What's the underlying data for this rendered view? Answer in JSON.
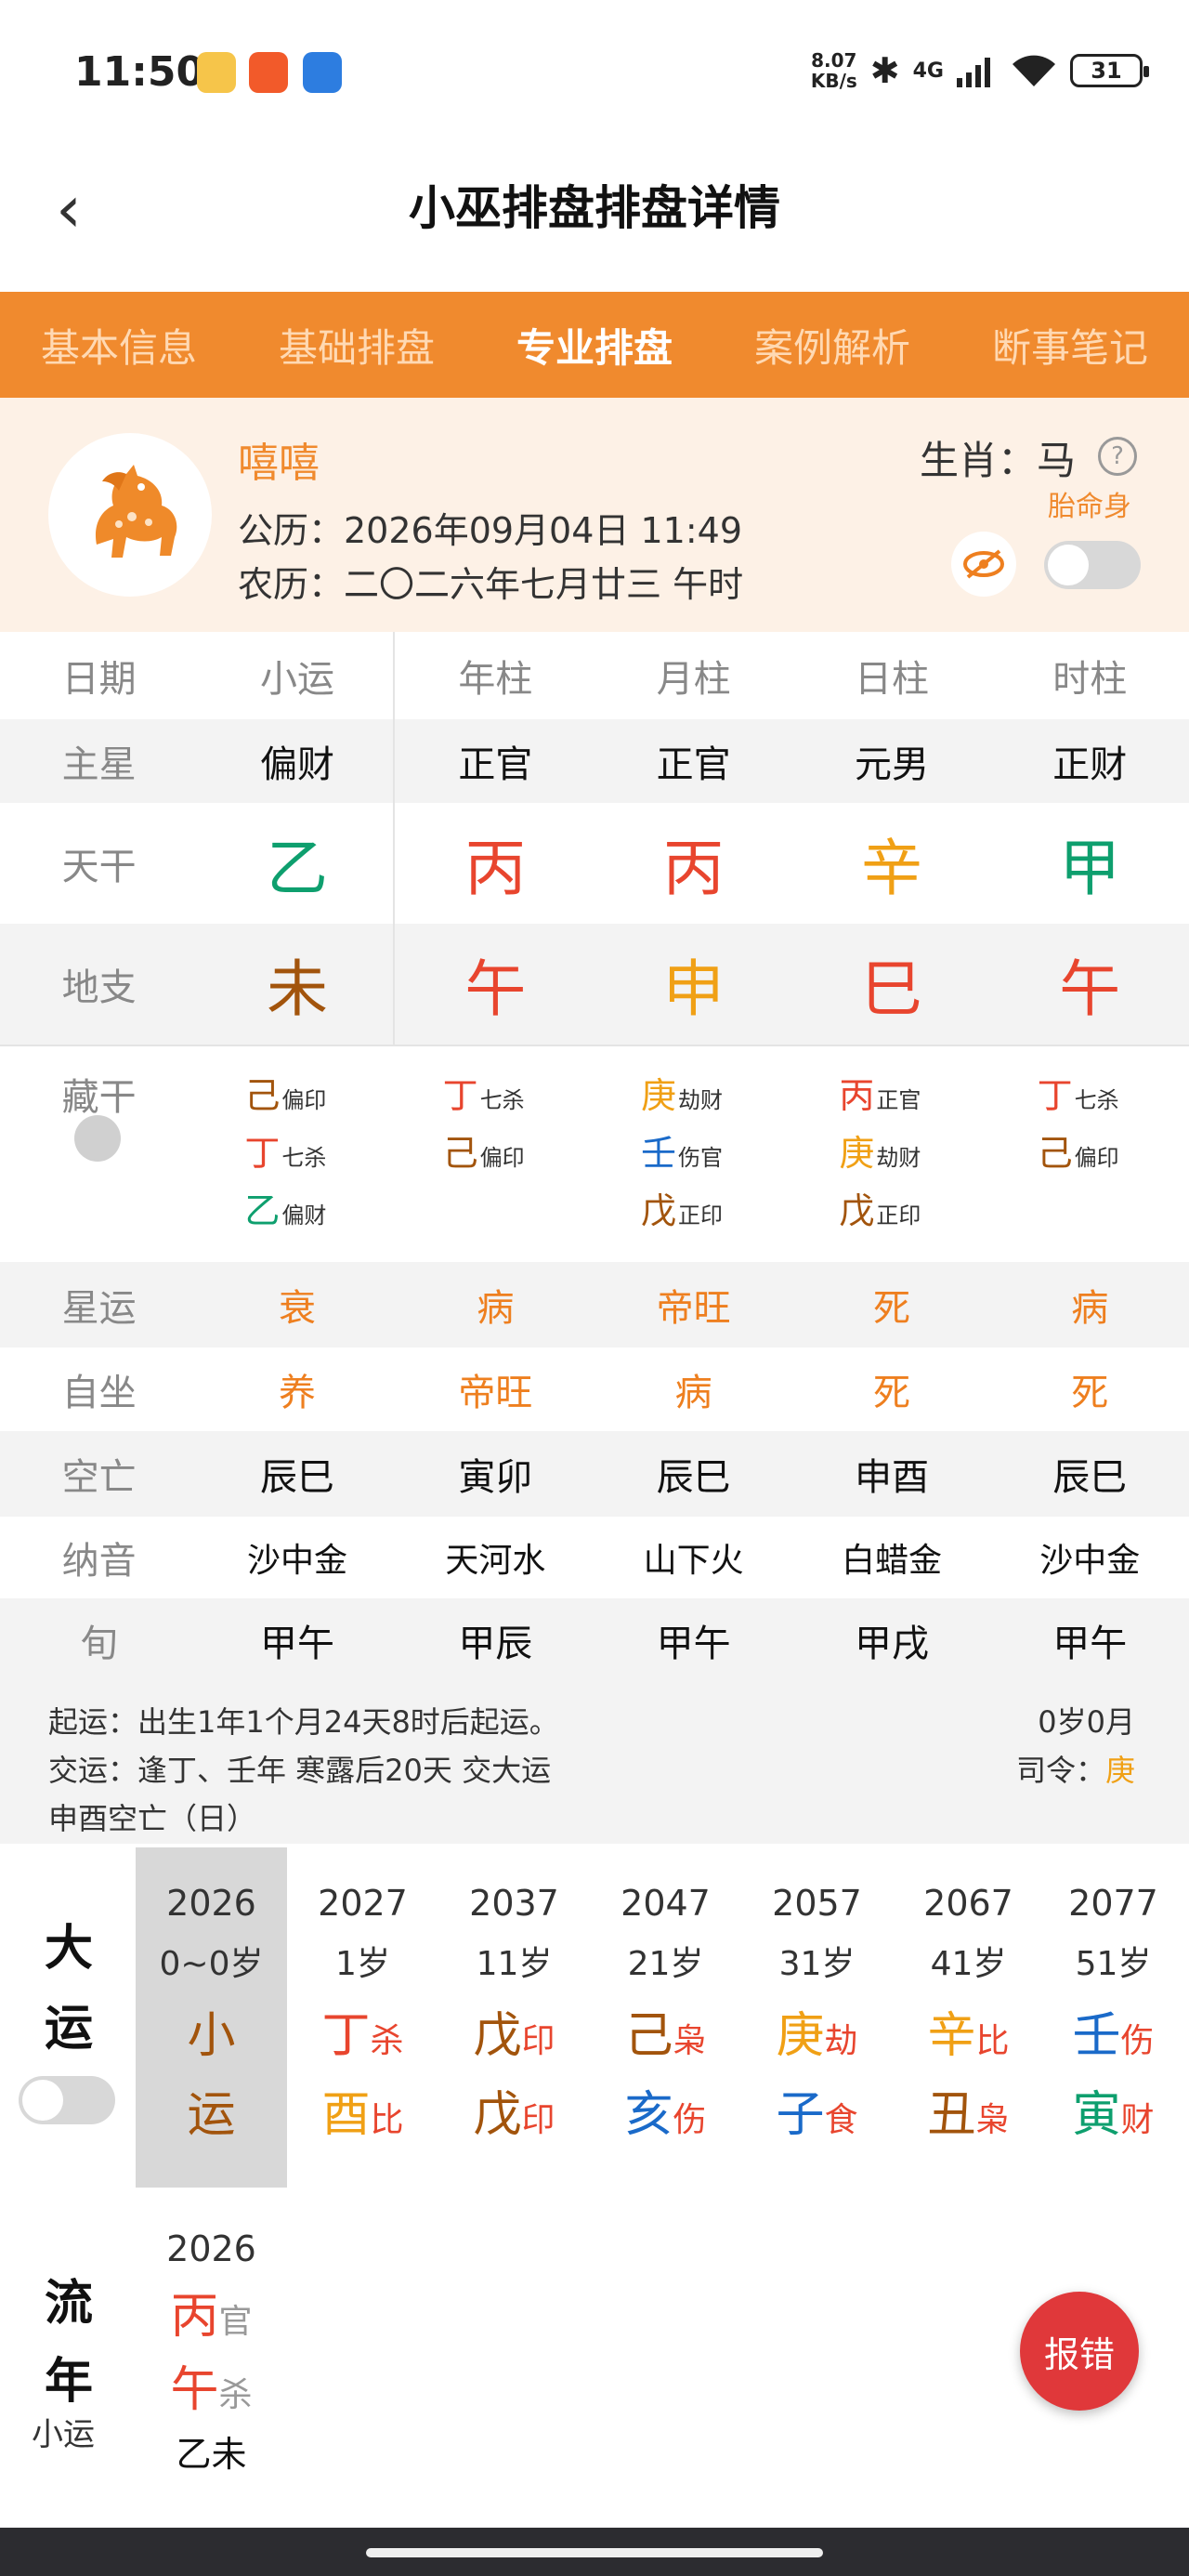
{
  "status": {
    "time": "11:50",
    "net": "8.07",
    "net_unit": "KB/s",
    "network": "4G",
    "battery": "31"
  },
  "header": {
    "title": "小巫排盘排盘详情"
  },
  "tabs": [
    "基本信息",
    "基础排盘",
    "专业排盘",
    "案例解析",
    "断事笔记"
  ],
  "active_tab": 2,
  "profile": {
    "name": "嘻嘻",
    "solar": "公历：2026年09月04日 11:49",
    "lunar": "农历：二〇二六年七月廿三 午时",
    "zodiac": "生肖：马",
    "taiming": "胎命身"
  },
  "grid": {
    "header": [
      "日期",
      "小运",
      "年柱",
      "月柱",
      "日柱",
      "时柱"
    ],
    "main_star": {
      "label": "主星",
      "values": [
        "偏财",
        "正官",
        "正官",
        "元男",
        "正财"
      ]
    },
    "tiangan": {
      "label": "天干",
      "values": [
        "乙",
        "丙",
        "丙",
        "辛",
        "甲"
      ]
    },
    "dizhi": {
      "label": "地支",
      "values": [
        "未",
        "午",
        "申",
        "巳",
        "午"
      ]
    },
    "canggan": {
      "label": "藏干",
      "cols": [
        [
          {
            "c": "己",
            "s": "偏印"
          },
          {
            "c": "丁",
            "s": "七杀"
          },
          {
            "c": "乙",
            "s": "偏财"
          }
        ],
        [
          {
            "c": "丁",
            "s": "七杀"
          },
          {
            "c": "己",
            "s": "偏印"
          }
        ],
        [
          {
            "c": "庚",
            "s": "劫财"
          },
          {
            "c": "壬",
            "s": "伤官"
          },
          {
            "c": "戊",
            "s": "正印"
          }
        ],
        [
          {
            "c": "丙",
            "s": "正官"
          },
          {
            "c": "庚",
            "s": "劫财"
          },
          {
            "c": "戊",
            "s": "正印"
          }
        ],
        [
          {
            "c": "丁",
            "s": "七杀"
          },
          {
            "c": "己",
            "s": "偏印"
          }
        ]
      ]
    },
    "xingyun": {
      "label": "星运",
      "values": [
        "衰",
        "病",
        "帝旺",
        "死",
        "病"
      ]
    },
    "zizuo": {
      "label": "自坐",
      "values": [
        "养",
        "帝旺",
        "病",
        "死",
        "死"
      ]
    },
    "kongwang": {
      "label": "空亡",
      "values": [
        "辰巳",
        "寅卯",
        "辰巳",
        "申酉",
        "辰巳"
      ]
    },
    "nayin": {
      "label": "纳音",
      "values": [
        "沙中金",
        "天河水",
        "山下火",
        "白蜡金",
        "沙中金"
      ]
    },
    "xun": {
      "label": "旬",
      "values": [
        "甲午",
        "甲辰",
        "甲午",
        "甲戌",
        "甲午"
      ]
    }
  },
  "qiyun": {
    "line1": "起运：出生1年1个月24天8时后起运。",
    "line2": "交运：逢丁、壬年 寒露后20天 交大运",
    "line3": "申酉空亡（日）",
    "age": "0岁0月",
    "siling_label": "司令：",
    "siling_value": "庚"
  },
  "dayun": {
    "label1": "大",
    "label2": "运",
    "first": {
      "year": "2026",
      "age": "0~0岁",
      "t1": "小",
      "t2": "运"
    },
    "cols": [
      {
        "year": "2027",
        "age": "1岁",
        "g": "丁",
        "gs": "杀",
        "z": "酉",
        "zs": "比"
      },
      {
        "year": "2037",
        "age": "11岁",
        "g": "戊",
        "gs": "印",
        "z": "戊",
        "zs": "印"
      },
      {
        "year": "2047",
        "age": "21岁",
        "g": "己",
        "gs": "枭",
        "z": "亥",
        "zs": "伤"
      },
      {
        "year": "2057",
        "age": "31岁",
        "g": "庚",
        "gs": "劫",
        "z": "子",
        "zs": "食"
      },
      {
        "year": "2067",
        "age": "41岁",
        "g": "辛",
        "gs": "比",
        "z": "丑",
        "zs": "枭"
      },
      {
        "year": "2077",
        "age": "51岁",
        "g": "壬",
        "gs": "伤",
        "z": "寅",
        "zs": "财"
      }
    ]
  },
  "liunian": {
    "label1": "流",
    "label2": "年",
    "sub": "小运",
    "year": "2026",
    "g": "丙",
    "gs": "官",
    "z": "午",
    "zs": "杀",
    "xy": "乙未"
  },
  "report": "报错",
  "colors": {
    "orange": "#f08a2e",
    "red": "#e8452e",
    "green": "#0e9f6e",
    "gold": "#f0a015",
    "brown": "#a2540c",
    "blue": "#1a6ac9"
  }
}
